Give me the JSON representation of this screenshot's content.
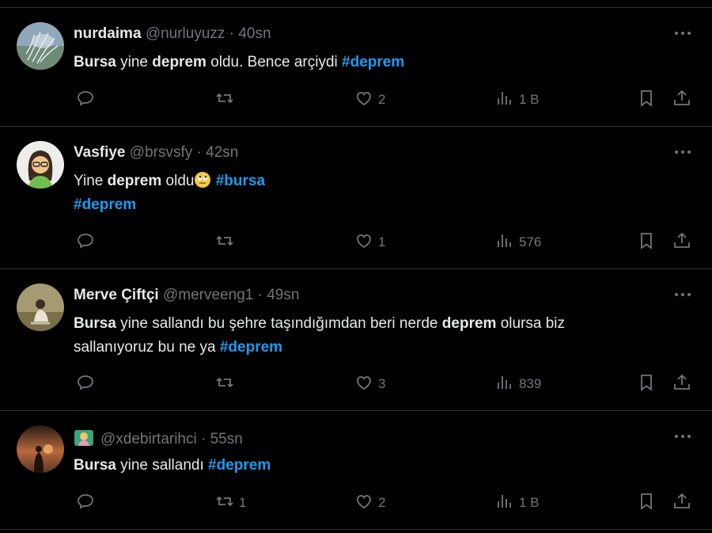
{
  "tweets": [
    {
      "name": "nurdaima",
      "handle": "@nurluyuzz",
      "separator": "·",
      "time": "40sn",
      "body": [
        {
          "t": "Bursa",
          "s": "b"
        },
        {
          "t": " yine ",
          "s": ""
        },
        {
          "t": "deprem",
          "s": "b"
        },
        {
          "t": " oldu. Bence arçiydi ",
          "s": ""
        },
        {
          "t": "#deprem",
          "s": "tag"
        }
      ],
      "replies": "",
      "retweets": "",
      "likes": "2",
      "views": "1 B"
    },
    {
      "name": "Vasfiye",
      "handle": "@brsvsfy",
      "separator": "·",
      "time": "42sn",
      "body_line1": [
        {
          "t": "Yine ",
          "s": ""
        },
        {
          "t": "deprem",
          "s": "b"
        },
        {
          "t": " oldu",
          "s": ""
        }
      ],
      "body_emoji": "face-with-rolling-eyes",
      "body_line1_tag": "#bursa",
      "body_line2_tag": "#deprem",
      "replies": "",
      "retweets": "",
      "likes": "1",
      "views": "576"
    },
    {
      "name": "Merve Çiftçi",
      "handle": "@merveeng1",
      "separator": "·",
      "time": "49sn",
      "body_line1": [
        {
          "t": "Bursa",
          "s": "b"
        },
        {
          "t": " yine sallandı bu şehre taşındığımdan beri nerde ",
          "s": ""
        },
        {
          "t": "deprem",
          "s": "b"
        },
        {
          "t": " olursa biz",
          "s": ""
        }
      ],
      "body_line2": [
        {
          "t": "sallanıyoruz bu ne ya  ",
          "s": ""
        },
        {
          "t": "#deprem",
          "s": "tag"
        }
      ],
      "replies": "",
      "retweets": "",
      "likes": "3",
      "views": "839"
    },
    {
      "name_emoji": "woman-tipping-hand-badge",
      "handle": "@xdebirtarihci",
      "separator": "·",
      "time": "55sn",
      "body": [
        {
          "t": "Bursa",
          "s": "b"
        },
        {
          "t": " yine sallandı ",
          "s": ""
        },
        {
          "t": "#deprem",
          "s": "tag"
        }
      ],
      "replies": "",
      "retweets": "1",
      "likes": "2",
      "views": "1 B"
    }
  ],
  "icons": {
    "reply": "reply-icon",
    "retweet": "retweet-icon",
    "like": "heart-icon",
    "views": "views-icon",
    "bookmark": "bookmark-icon",
    "share": "share-icon",
    "more": "more-icon"
  },
  "colors": {
    "background": "#000000",
    "text": "#e7e9ea",
    "muted": "#71767b",
    "hashtag": "#1d9bf0",
    "divider": "#2f3336"
  }
}
